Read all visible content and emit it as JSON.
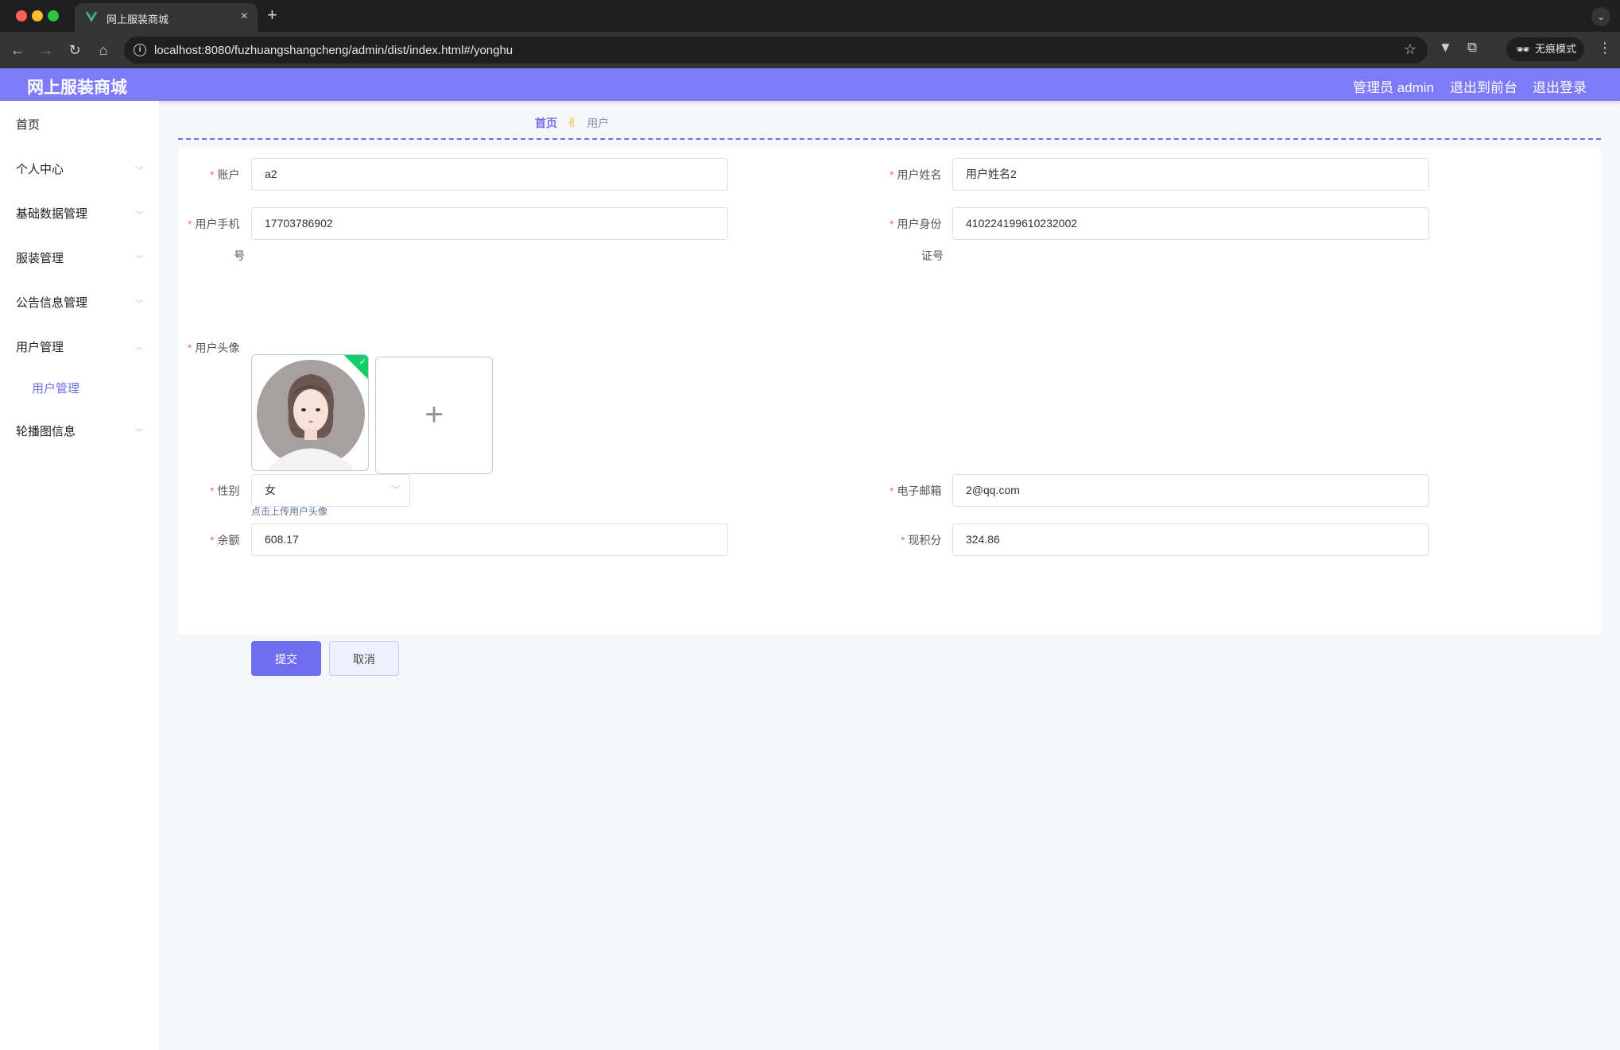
{
  "browser": {
    "tab_title": "网上服装商城",
    "tab_close": "×",
    "new_tab": "+",
    "url": "localhost:8080/fuzhuangshangcheng/admin/dist/index.html#/yonghu",
    "incognito_label": "无痕模式"
  },
  "header": {
    "brand": "网上服装商城",
    "admin_label": "管理员 admin",
    "to_front": "退出到前台",
    "logout": "退出登录",
    "accent_color": "#7d7bf8"
  },
  "sidebar": {
    "items": [
      {
        "label": "首页"
      },
      {
        "label": "个人中心"
      },
      {
        "label": "基础数据管理"
      },
      {
        "label": "服装管理"
      },
      {
        "label": "公告信息管理"
      },
      {
        "label": "用户管理"
      },
      {
        "label": "轮播图信息"
      }
    ],
    "sub_items": [
      {
        "label": "用户管理"
      }
    ]
  },
  "breadcrumb": {
    "home": "首页",
    "separator": "✌",
    "current": "用户"
  },
  "form": {
    "required_mark": "*",
    "account": {
      "label": "账户",
      "value": "a2"
    },
    "name": {
      "label": "用户姓名",
      "value": "用户姓名2"
    },
    "phone": {
      "label": "用户手机",
      "label_cont": "号",
      "value": "17703786902"
    },
    "id_card": {
      "label": "用户身份",
      "label_cont": "证号",
      "value": "410224199610232002"
    },
    "avatar": {
      "label": "用户头像",
      "hint": "点击上传用户头像",
      "upload_plus": "+"
    },
    "gender": {
      "label": "性别",
      "value": "女"
    },
    "email": {
      "label": "电子邮箱",
      "value": "2@qq.com"
    },
    "balance": {
      "label": "余额",
      "value": "608.17"
    },
    "points": {
      "label": "现积分",
      "value": "324.86"
    },
    "submit": "提交",
    "cancel": "取消"
  }
}
